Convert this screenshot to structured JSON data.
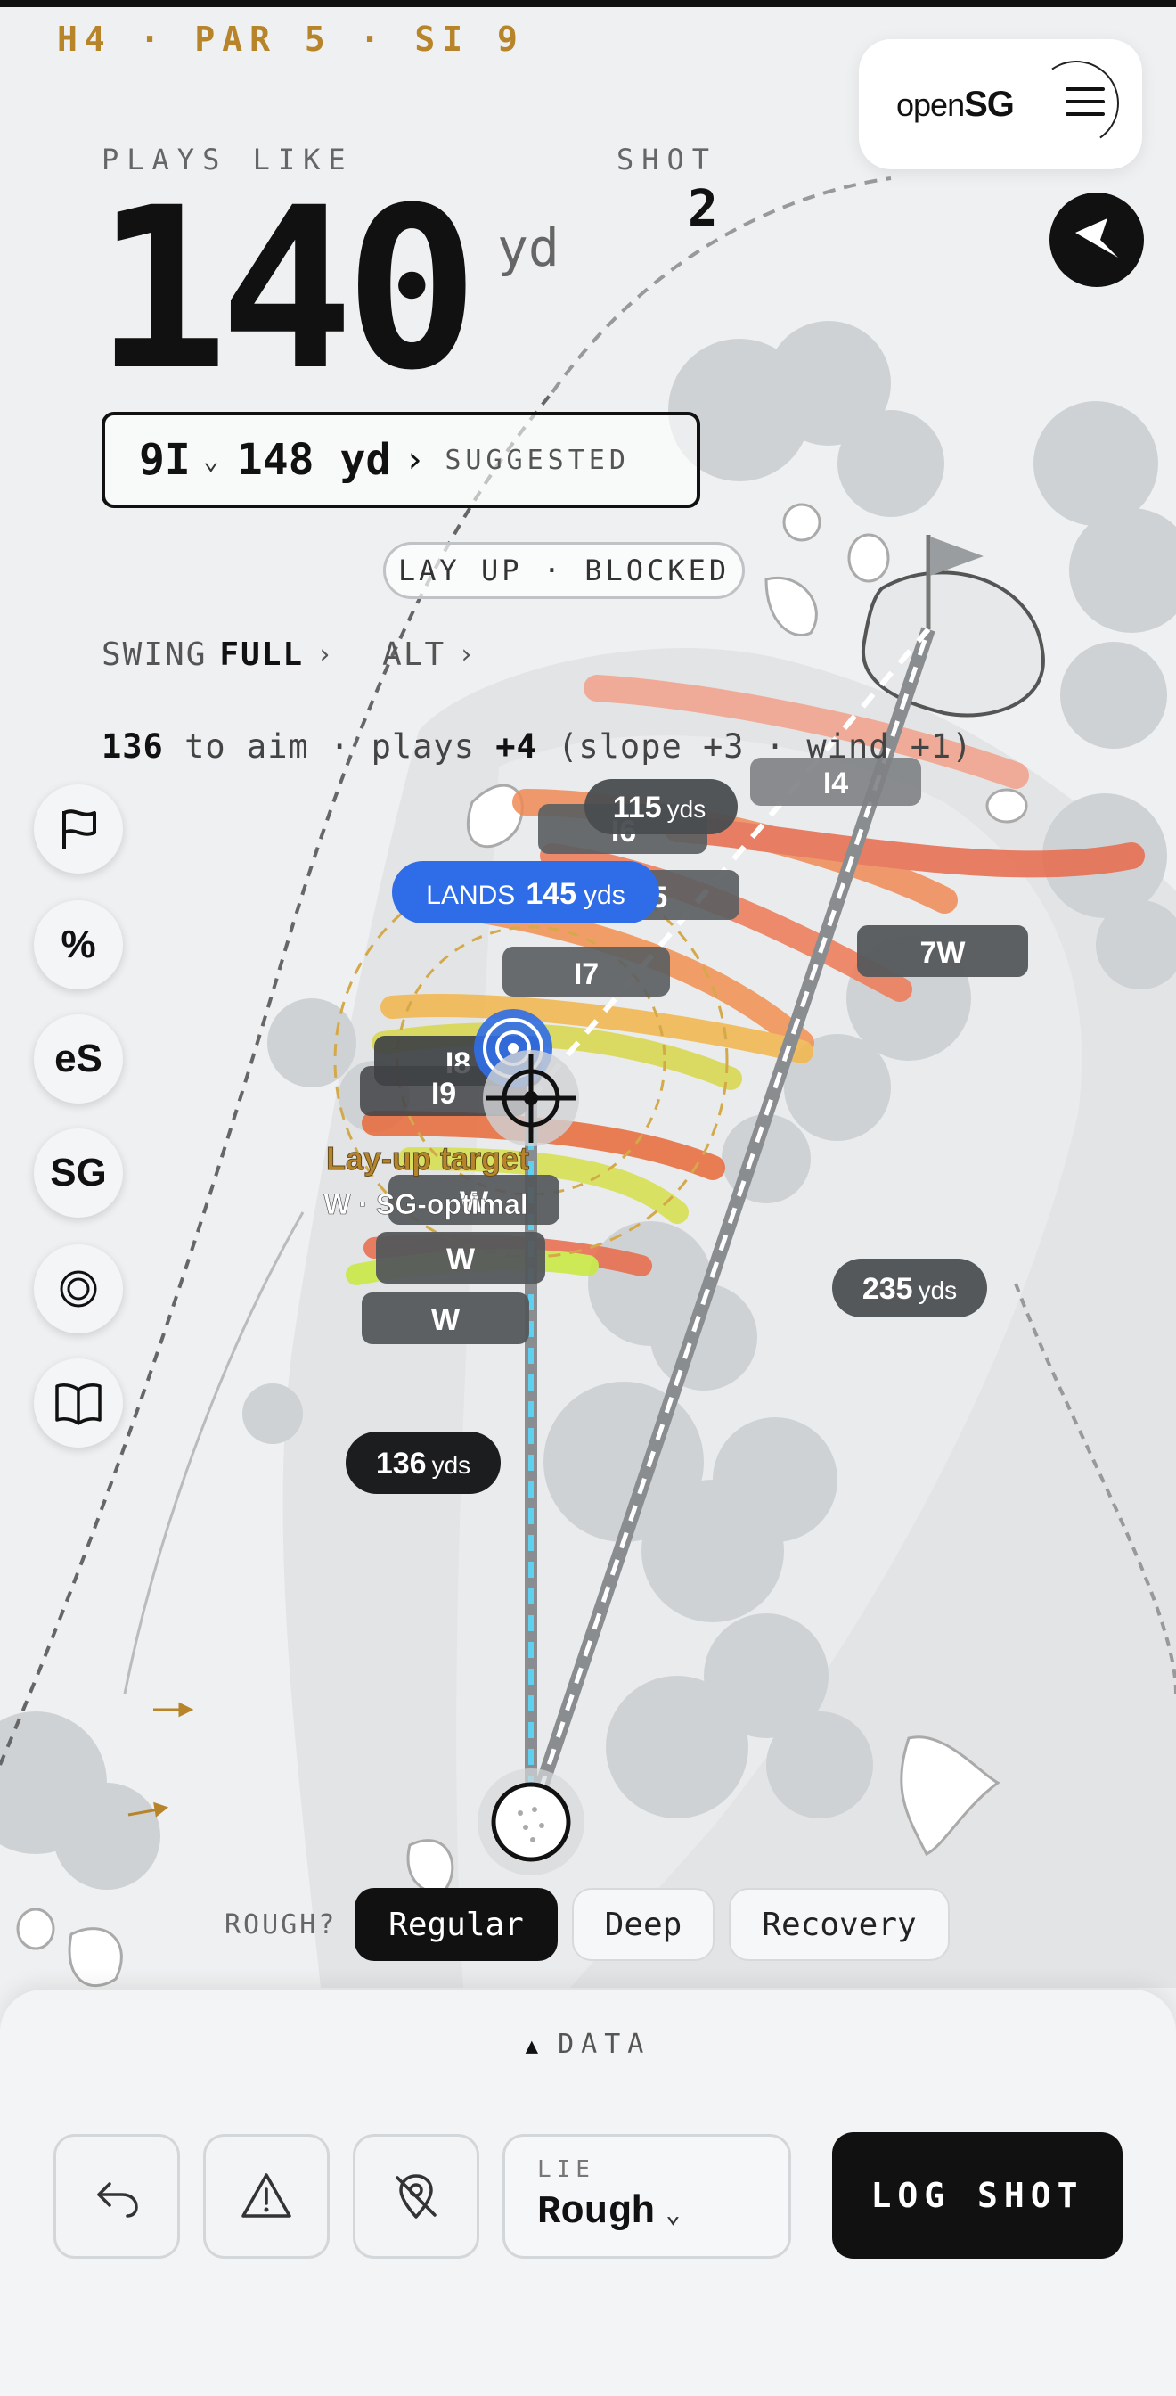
{
  "header": {
    "hole_info": "H4 · PAR 5 · SI 9",
    "logo_light": "open",
    "logo_bold": "SG"
  },
  "plays_like": {
    "label": "PLAYS LIKE",
    "value": "140",
    "unit": "yd"
  },
  "shot": {
    "label": "SHOT",
    "value": "2"
  },
  "club_selector": {
    "club": "9I",
    "distance": "148 yd",
    "badge": "SUGGESTED"
  },
  "layup_pill": "LAY UP · BLOCKED",
  "swing": {
    "label": "SWING",
    "value": "FULL",
    "alt_label": "ALT"
  },
  "aim": {
    "yardage": "136",
    "text1": " to aim · plays ",
    "plays_delta": "+4",
    "text2": " (slope +3 · wind +1)"
  },
  "tools": [
    {
      "name": "flag-tool",
      "label": ""
    },
    {
      "name": "percent-tool",
      "label": "%"
    },
    {
      "name": "es-tool",
      "label": "eS"
    },
    {
      "name": "sg-tool",
      "label": "SG"
    },
    {
      "name": "target-tool",
      "label": ""
    },
    {
      "name": "book-tool",
      "label": ""
    }
  ],
  "map": {
    "landing_label": "LANDS",
    "landing_value": "145",
    "landing_unit": "yds",
    "dist_top_value": "115",
    "dist_top_unit": "yds",
    "dist_right_value": "235",
    "dist_right_unit": "yds",
    "dist_bottom_value": "136",
    "dist_bottom_unit": "yds",
    "layup_title": "Lay-up target",
    "layup_sub": "W · SG-optimal",
    "club_chips": [
      "I4",
      "I6",
      "I5",
      "7W",
      "I7",
      "I8",
      "I9",
      "W",
      "W",
      "W"
    ]
  },
  "rough": {
    "label": "ROUGH?",
    "options": [
      "Regular",
      "Deep",
      "Recovery"
    ],
    "selected": "Regular"
  },
  "panel": {
    "data_label": "DATA",
    "lie_label": "LIE",
    "lie_value": "Rough",
    "log_label": "LOG SHOT"
  },
  "colors": {
    "accent_gold": "#b8842a",
    "landing_blue": "#2f6de8",
    "dark": "#111111"
  }
}
